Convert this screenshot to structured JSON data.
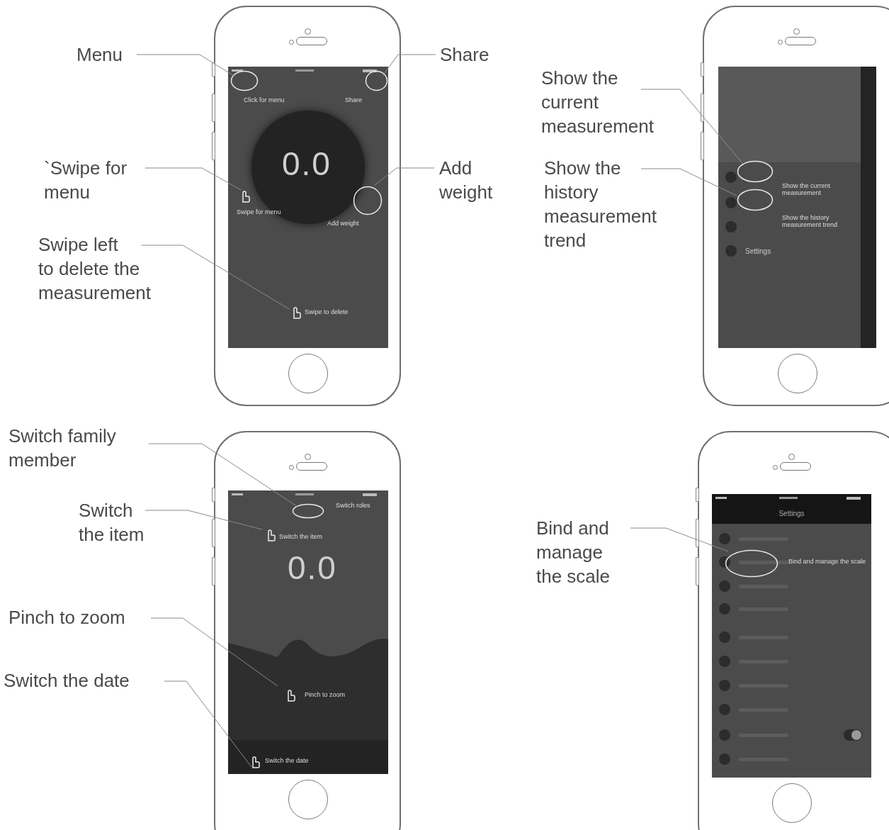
{
  "phones": [
    {
      "screen": {
        "kind": "home",
        "weight": "0.0",
        "hints": [
          {
            "text": "Click for menu"
          },
          {
            "text": "Share"
          },
          {
            "text": "Swipe for menu"
          },
          {
            "text": "Add weight"
          },
          {
            "text": "Swipe to delete"
          }
        ]
      },
      "callouts": [
        {
          "lines": [
            "Menu"
          ]
        },
        {
          "lines": [
            "Share"
          ]
        },
        {
          "lines": [
            "`Swipe for",
            "menu"
          ]
        },
        {
          "lines": [
            "Add",
            "weight"
          ]
        },
        {
          "lines": [
            "Swipe left",
            "to delete the",
            "measurement"
          ]
        }
      ]
    },
    {
      "screen": {
        "kind": "side_menu",
        "hints": [
          {
            "text": "Show the current measurement"
          },
          {
            "text": "Show the history measurement trend"
          }
        ],
        "menu_items": [
          {
            "label": "Settings"
          }
        ]
      },
      "callouts": [
        {
          "lines": [
            "Show the",
            "current",
            "measurement"
          ]
        },
        {
          "lines": [
            "Show the",
            "history",
            "measurement",
            "trend"
          ]
        }
      ]
    },
    {
      "screen": {
        "kind": "trend",
        "weight": "0.0",
        "hints": [
          {
            "text": "Switch roles"
          },
          {
            "text": "Switch the item"
          },
          {
            "text": "Pinch to zoom"
          },
          {
            "text": "Switch the date"
          }
        ]
      },
      "callouts": [
        {
          "lines": [
            "Switch family",
            "member"
          ]
        },
        {
          "lines": [
            "Switch",
            "the item"
          ]
        },
        {
          "lines": [
            "Pinch to zoom"
          ]
        },
        {
          "lines": [
            "Switch the date"
          ]
        }
      ]
    },
    {
      "screen": {
        "kind": "settings",
        "title": "Settings",
        "hints": [
          {
            "text": "Bind and manage the scale"
          }
        ],
        "toggle": {
          "on": true
        }
      },
      "callouts": [
        {
          "lines": [
            "Bind and",
            "manage",
            "the scale"
          ]
        }
      ]
    }
  ]
}
